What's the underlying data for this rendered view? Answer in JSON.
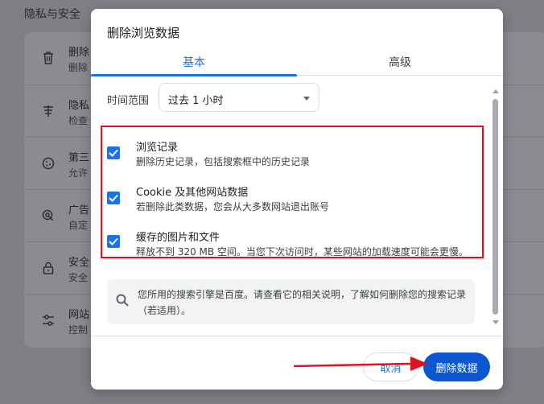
{
  "background": {
    "heading": "隐私与安全",
    "rows": [
      {
        "icon": "trash-icon",
        "title": "删除",
        "sub": "删除"
      },
      {
        "icon": "cookie-shield-icon",
        "title": "隐私",
        "sub": "检查"
      },
      {
        "icon": "cookie-icon",
        "title": "第三",
        "sub": "允许"
      },
      {
        "icon": "ad-privacy-icon",
        "title": "广告",
        "sub": "自定"
      },
      {
        "icon": "lock-icon",
        "title": "安全",
        "sub": "安全"
      },
      {
        "icon": "sliders-icon",
        "title": "网站",
        "sub": "控制"
      }
    ]
  },
  "dialog": {
    "title": "删除浏览数据",
    "tabs": [
      {
        "label": "基本",
        "active": true
      },
      {
        "label": "高级",
        "active": false
      }
    ],
    "time_range": {
      "label": "时间范围",
      "value": "过去 1 小时"
    },
    "items": [
      {
        "title": "浏览记录",
        "desc": "删除历史记录，包括搜索框中的历史记录",
        "checked": true
      },
      {
        "title": "Cookie 及其他网站数据",
        "desc": "若删除此类数据，您会从大多数网站退出账号",
        "checked": true
      },
      {
        "title": "缓存的图片和文件",
        "desc": "释放不到 320 MB 空间。当您下次访问时，某些网站的加载速度可能会更慢。",
        "checked": true
      }
    ],
    "info": {
      "icon": "search-icon",
      "text": "您所用的搜索引擎是百度。请查看它的相关说明，了解如何删除您的搜索记录（若适用）。"
    },
    "buttons": {
      "cancel": "取消",
      "delete": "删除数据"
    }
  },
  "colors": {
    "accent": "#1a73e8",
    "primary_button": "#0b57d0",
    "annotation": "#e1121d"
  }
}
